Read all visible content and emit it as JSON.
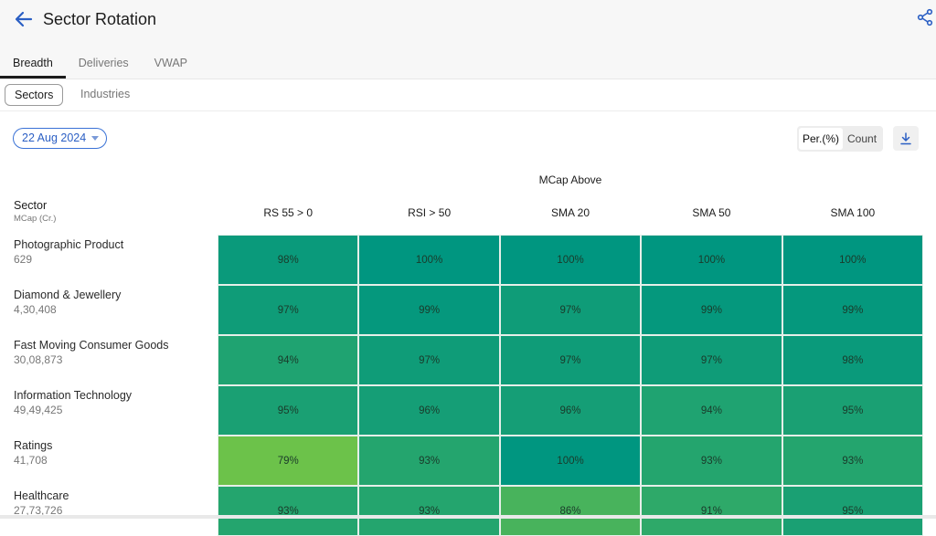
{
  "header": {
    "title": "Sector Rotation",
    "back_icon": "arrow-left-icon",
    "share_icon": "share-icon"
  },
  "tabs": [
    {
      "label": "Breadth",
      "active": true
    },
    {
      "label": "Deliveries",
      "active": false
    },
    {
      "label": "VWAP",
      "active": false
    }
  ],
  "subtabs": [
    {
      "label": "Sectors",
      "active": true
    },
    {
      "label": "Industries",
      "active": false
    }
  ],
  "date_selector": {
    "value": "22 Aug 2024",
    "icon": "caret-down-icon"
  },
  "view_toggle": {
    "options": [
      "Per.(%)",
      "Count"
    ],
    "selected": "Per.(%)"
  },
  "download": {
    "icon": "download-icon"
  },
  "table": {
    "group_label": "MCap Above",
    "sector_header": "Sector",
    "sector_subheader": "MCap (Cr.)",
    "columns": [
      "RS 55 > 0",
      "RSI > 50",
      "SMA 20",
      "SMA 50",
      "SMA 100"
    ],
    "rows": [
      {
        "name": "Photographic Product",
        "mcap": "629",
        "values": [
          "98%",
          "100%",
          "100%",
          "100%",
          "100%"
        ]
      },
      {
        "name": "Diamond & Jewellery",
        "mcap": "4,30,408",
        "values": [
          "97%",
          "99%",
          "97%",
          "99%",
          "99%"
        ]
      },
      {
        "name": "Fast Moving Consumer Goods",
        "mcap": "30,08,873",
        "values": [
          "94%",
          "97%",
          "97%",
          "97%",
          "98%"
        ]
      },
      {
        "name": "Information Technology",
        "mcap": "49,49,425",
        "values": [
          "95%",
          "96%",
          "96%",
          "94%",
          "95%"
        ]
      },
      {
        "name": "Ratings",
        "mcap": "41,708",
        "values": [
          "79%",
          "93%",
          "100%",
          "93%",
          "93%"
        ]
      },
      {
        "name": "Healthcare",
        "mcap": "27,73,726",
        "values": [
          "93%",
          "93%",
          "86%",
          "91%",
          "95%"
        ]
      }
    ]
  },
  "colors": {
    "accent": "#2b5fc4",
    "heat_high": "#009680",
    "heat_low": "#6cc24a"
  }
}
